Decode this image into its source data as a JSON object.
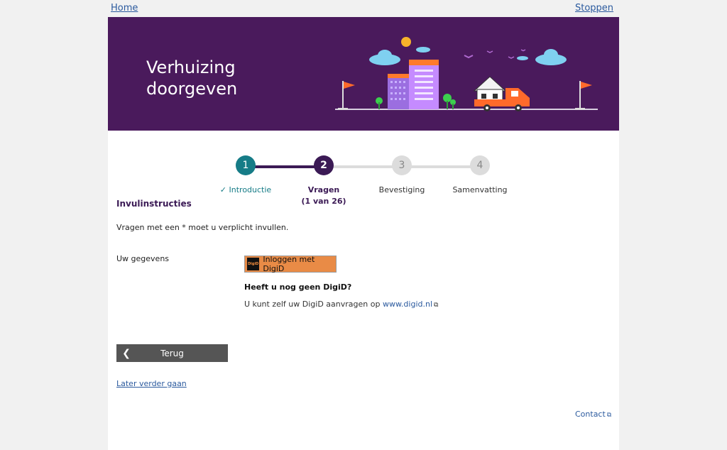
{
  "nav": {
    "home": "Home",
    "stop": "Stoppen"
  },
  "banner": {
    "title": "Verhuizing\ndoorgeven"
  },
  "steps": [
    {
      "number": "1",
      "label": "Introductie",
      "check": "✓",
      "state": "done"
    },
    {
      "number": "2",
      "label": "Vragen",
      "sublabel": "(1 van 26)",
      "state": "current"
    },
    {
      "number": "3",
      "label": "Bevestiging",
      "state": "todo"
    },
    {
      "number": "4",
      "label": "Samenvatting",
      "state": "todo"
    }
  ],
  "instructions": {
    "heading": "Invulinstructies",
    "text": "Vragen met een * moet u verplicht invullen."
  },
  "gegevens": {
    "label": "Uw gegevens"
  },
  "digid": {
    "logo_text": "DigiD",
    "button": "Inloggen met DigiD",
    "no_digid_heading": "Heeft u nog geen DigiD?",
    "apply_text": "U kunt zelf uw DigiD aanvragen op ",
    "link": "www.digid.nl"
  },
  "buttons": {
    "back": "Terug",
    "later": "Later verder gaan"
  },
  "footer": {
    "contact": "Contact"
  },
  "colors": {
    "banner": "#4a1a5c",
    "step_done": "#167c87",
    "step_current": "#3b1a55",
    "step_todo": "#dcdcdc",
    "digid_button": "#e98b46"
  }
}
